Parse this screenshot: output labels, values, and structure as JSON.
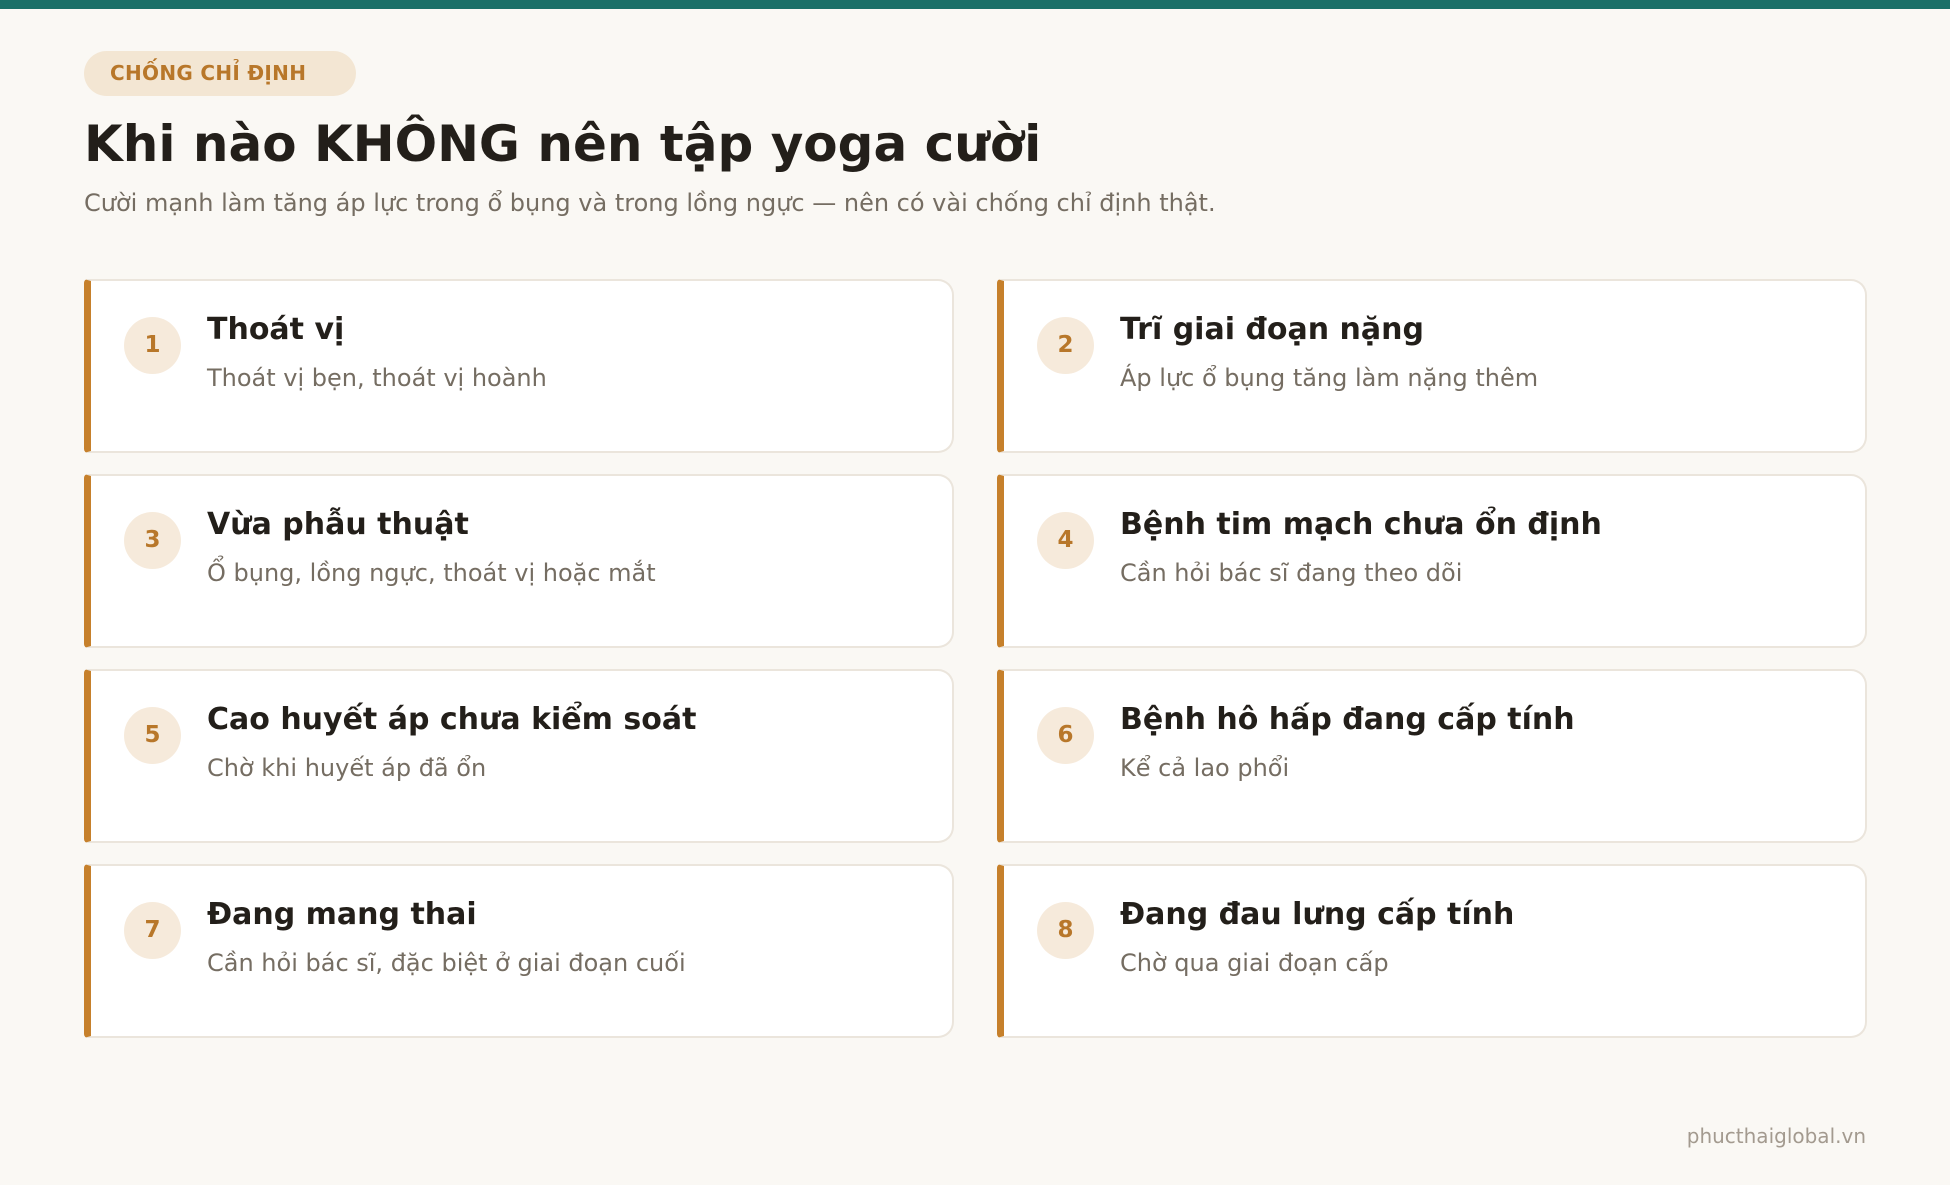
{
  "colors": {
    "accent": "#c6802b",
    "top_bar": "#1b7068",
    "background": "#faf8f4",
    "badge_bg": "#f3e6d3"
  },
  "header": {
    "badge": "CHỐNG CHỈ ĐỊNH",
    "title": "Khi nào KHÔNG nên tập yoga cười",
    "subtitle": "Cười mạnh làm tăng áp lực trong ổ bụng và trong lồng ngực — nên có vài chống chỉ định thật."
  },
  "items": [
    {
      "number": "1",
      "title": "Thoát vị",
      "description": "Thoát vị bẹn, thoát vị hoành"
    },
    {
      "number": "2",
      "title": "Trĩ giai đoạn nặng",
      "description": "Áp lực ổ bụng tăng làm nặng thêm"
    },
    {
      "number": "3",
      "title": "Vừa phẫu thuật",
      "description": "Ổ bụng, lồng ngực, thoát vị hoặc mắt"
    },
    {
      "number": "4",
      "title": "Bệnh tim mạch chưa ổn định",
      "description": "Cần hỏi bác sĩ đang theo dõi"
    },
    {
      "number": "5",
      "title": "Cao huyết áp chưa kiểm soát",
      "description": "Chờ khi huyết áp đã ổn"
    },
    {
      "number": "6",
      "title": "Bệnh hô hấp đang cấp tính",
      "description": "Kể cả lao phổi"
    },
    {
      "number": "7",
      "title": "Đang mang thai",
      "description": "Cần hỏi bác sĩ, đặc biệt ở giai đoạn cuối"
    },
    {
      "number": "8",
      "title": "Đang đau lưng cấp tính",
      "description": "Chờ qua giai đoạn cấp"
    }
  ],
  "footer": {
    "site": "phucthaiglobal.vn"
  }
}
